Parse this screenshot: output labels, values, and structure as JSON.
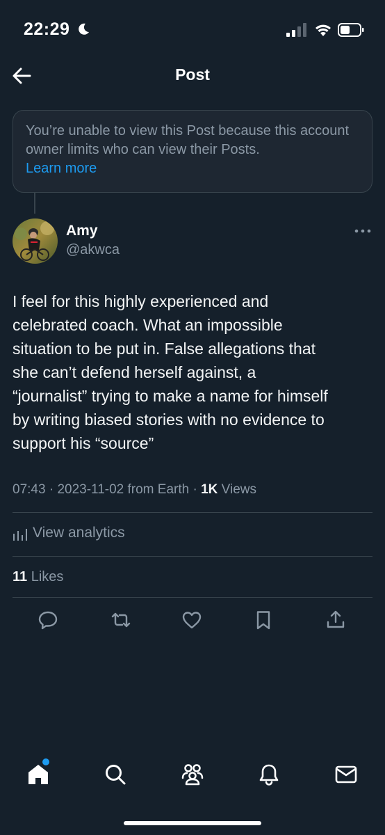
{
  "status_bar": {
    "time": "22:29",
    "icons": [
      "moon-icon",
      "signal-icon",
      "wifi-icon",
      "battery-icon"
    ]
  },
  "header": {
    "title": "Post",
    "back_icon": "arrow-left-icon"
  },
  "notice": {
    "text": "You’re unable to view this Post because this account owner limits who can view their Posts.",
    "link": "Learn more"
  },
  "post": {
    "author": {
      "name": "Amy",
      "handle": "@akwca"
    },
    "text": "I feel for this highly experienced and\ncelebrated coach. What an impossible\nsituation to be put in.  False allegations that\nshe can’t defend herself against,  a\n“journalist” trying to make a name for himself\nby writing biased stories with no evidence to\nsupport his “source”",
    "meta": {
      "time": "07:43",
      "date": "2023-11-02",
      "source": "from Earth",
      "views_count": "1K",
      "views_label": "Views"
    },
    "analytics_label": "View analytics",
    "likes": {
      "count": "11",
      "label": "Likes"
    },
    "actions": [
      "reply-icon",
      "repost-icon",
      "like-icon",
      "bookmark-icon",
      "share-icon"
    ]
  },
  "tabbar": {
    "tabs": [
      "home-icon",
      "search-icon",
      "communities-icon",
      "notifications-icon",
      "messages-icon"
    ],
    "accent": "#1d9bf0"
  },
  "colors": {
    "background": "#15202b",
    "border": "#38444d",
    "secondary_text": "#8b98a5",
    "link": "#1d9bf0"
  }
}
